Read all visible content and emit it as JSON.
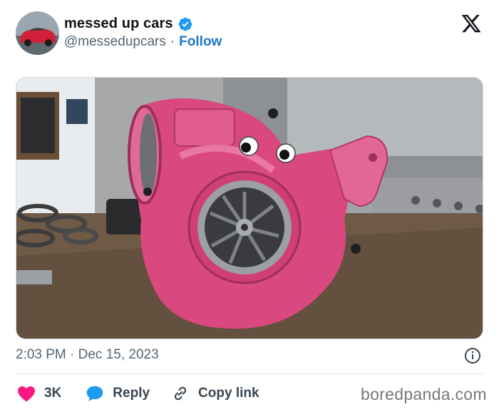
{
  "author": {
    "display_name": "messed up cars",
    "handle": "@messedupcars",
    "separator": "·",
    "follow_label": "Follow",
    "verified": true
  },
  "post": {
    "timestamp": "2:03 PM · Dec 15, 2023",
    "media_description_icon": "photo"
  },
  "actions": {
    "like_count": "3K",
    "reply_label": "Reply",
    "copy_link_label": "Copy link"
  },
  "watermark": "boredpanda.com",
  "colors": {
    "accent": "#1d77c7",
    "like": "#f91880",
    "reply": "#1d9bf0",
    "text_secondary": "#536471",
    "turbo_pink": "#e35b8f"
  }
}
